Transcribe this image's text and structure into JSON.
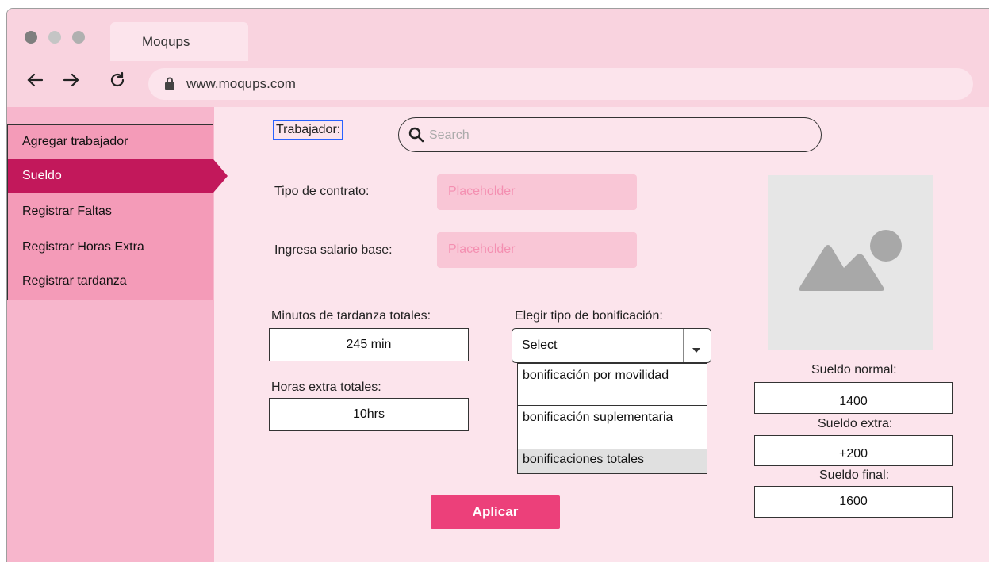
{
  "browser": {
    "tab_title": "Moqups",
    "url": "www.moqups.com",
    "icons": [
      "back-arrow-icon",
      "forward-arrow-icon",
      "reload-icon",
      "lock-icon"
    ],
    "dot_colors": [
      "#7f7f7f",
      "#c5c5c5",
      "#b0b0b0"
    ]
  },
  "sidebar": {
    "items": [
      {
        "label": "Agregar trabajador"
      },
      {
        "label": "Sueldo",
        "active": true
      },
      {
        "label": "Registrar Faltas"
      },
      {
        "label": "Registrar Horas Extra"
      },
      {
        "label": "Registrar tardanza"
      }
    ]
  },
  "form": {
    "trabajador_label": "Trabajador:",
    "search_placeholder": "Search",
    "tipo_contrato_label": "Tipo de contrato:",
    "tipo_contrato_placeholder": "Placeholder",
    "salario_base_label": "Ingresa salario base:",
    "salario_base_placeholder": "Placeholder",
    "tardanza_label": "Minutos de tardanza totales:",
    "tardanza_value": "245 min",
    "horas_extra_label": "Horas extra totales:",
    "horas_extra_value": "10hrs",
    "bonificacion_label": "Elegir tipo de bonificación:",
    "bonificacion_selected": "Select",
    "bonificacion_options": [
      {
        "label": "bonificación por movilidad"
      },
      {
        "label": "bonificación suplementaria"
      },
      {
        "label": "bonificaciones totales",
        "highlighted": true
      }
    ],
    "apply_label": "Aplicar"
  },
  "summary": {
    "sueldo_normal_label": "Sueldo normal:",
    "sueldo_normal_value": "1400",
    "sueldo_extra_label": "Sueldo extra:",
    "sueldo_extra_value": "+200",
    "sueldo_final_label": "Sueldo final:",
    "sueldo_final_value": "1600"
  },
  "colors": {
    "accent": "#ec407a",
    "active_menu": "#c2185b",
    "menu_bg": "#f49bb8",
    "page_bg": "#fce4ec"
  }
}
